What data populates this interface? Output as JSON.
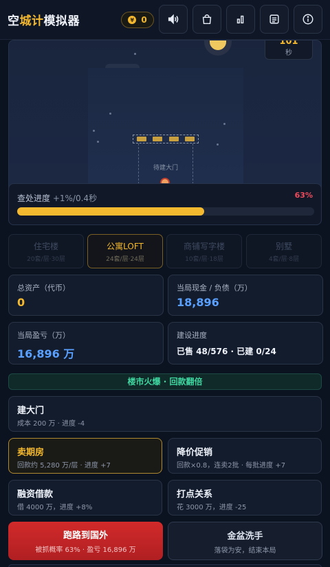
{
  "header": {
    "title_pre": "空",
    "title_hl": "城计",
    "title_post": "模拟器",
    "coins": "0",
    "coin_glyph": "¥",
    "buttons": [
      "sound-icon",
      "shop-bag-icon",
      "stats-chart-icon",
      "log-list-icon",
      "info-icon"
    ]
  },
  "scene": {
    "timer_value": "101",
    "timer_unit": "秒",
    "gate_label": "待建大门"
  },
  "progress": {
    "label": "查处进度",
    "rate": "+1%/0.4秒",
    "percent_text": "63%",
    "value": 0.63
  },
  "tabs": [
    {
      "name": "住宅楼",
      "sub": "20套/层·30层"
    },
    {
      "name": "公寓LOFT",
      "sub": "24套/层·24层"
    },
    {
      "name": "商铺写字楼",
      "sub": "10套/层·18层"
    },
    {
      "name": "别墅",
      "sub": "4套/层·8层"
    }
  ],
  "active_tab": 1,
  "stats": {
    "total_assets": {
      "label": "总资产（代币）",
      "value": "0"
    },
    "cash_debt": {
      "label": "当局现金 / 负债（万）",
      "value": "18,896"
    },
    "profit": {
      "label": "当局盈亏（万）",
      "value": "16,896 万"
    },
    "build": {
      "label": "建设进度",
      "value": "已售 48/576 · 已建 0/24"
    }
  },
  "banner": "楼市火爆 · 回款翻倍",
  "actions": {
    "build_gate": {
      "name": "建大门",
      "sub": "成本 200 万 · 进度 -4"
    },
    "presale": {
      "name": "卖期房",
      "sub": "回款约 5,280 万/层 · 进度 +7"
    },
    "discount": {
      "name": "降价促销",
      "sub": "回款×0.8，连卖2批 · 每批进度 +7"
    },
    "loan": {
      "name": "融资借款",
      "sub": "借 4000 万，进度 +8%"
    },
    "relations": {
      "name": "打点关系",
      "sub": "花 3000 万，进度 -25"
    }
  },
  "big_buttons": {
    "run": {
      "name": "跑路到国外",
      "sub": "被抓概率 63% · 盈亏 16,896 万"
    },
    "wash": {
      "name": "金盆洗手",
      "sub": "落袋为安，结束本局"
    }
  },
  "colors": {
    "accent": "#f5b92f",
    "danger": "#ef4b5c",
    "blue_value": "#5aa0ff",
    "green_banner": "#3fd6a0"
  }
}
